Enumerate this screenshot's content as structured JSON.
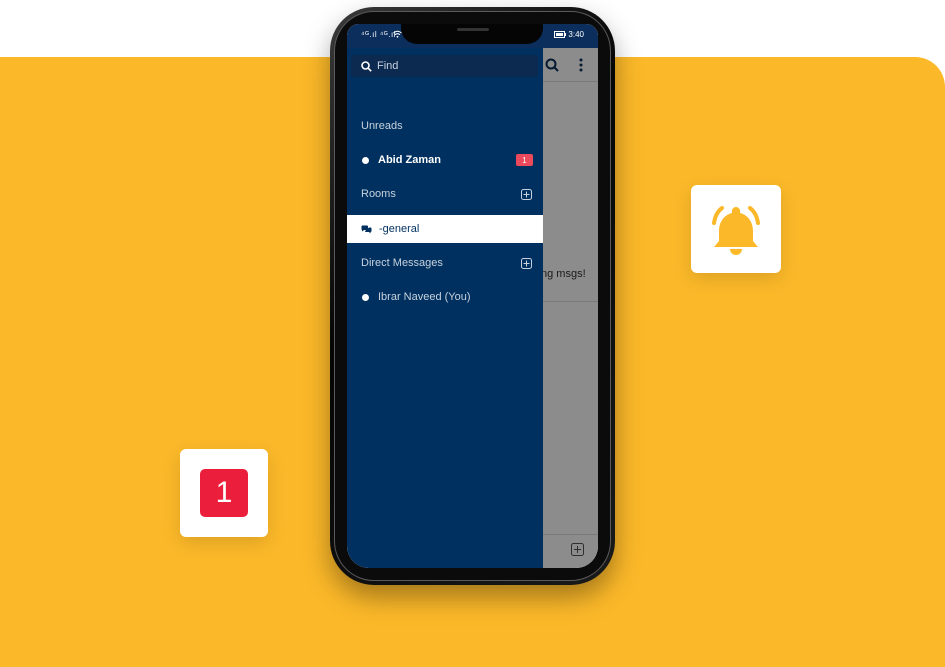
{
  "status_bar": {
    "left": "⁴ᴳ.ıl ⁴ᴳ.ıl",
    "right": "3:40"
  },
  "drawer": {
    "search_placeholder": "Find",
    "unreads_label": "Unreads",
    "unreads": [
      {
        "name": "Abid Zaman",
        "count": "1"
      }
    ],
    "rooms_label": "Rooms",
    "rooms": [
      {
        "name": "-general"
      }
    ],
    "dm_label": "Direct Messages",
    "direct_messages": [
      {
        "name": "Ibrar Naveed (You)"
      }
    ]
  },
  "behind": {
    "message_fragment": "ng msgs!"
  },
  "floating": {
    "badge_count": "1"
  },
  "colors": {
    "background": "#FBB829",
    "drawer": "#00305F",
    "badge": "#EB1F3B",
    "bell": "#FBB829"
  }
}
